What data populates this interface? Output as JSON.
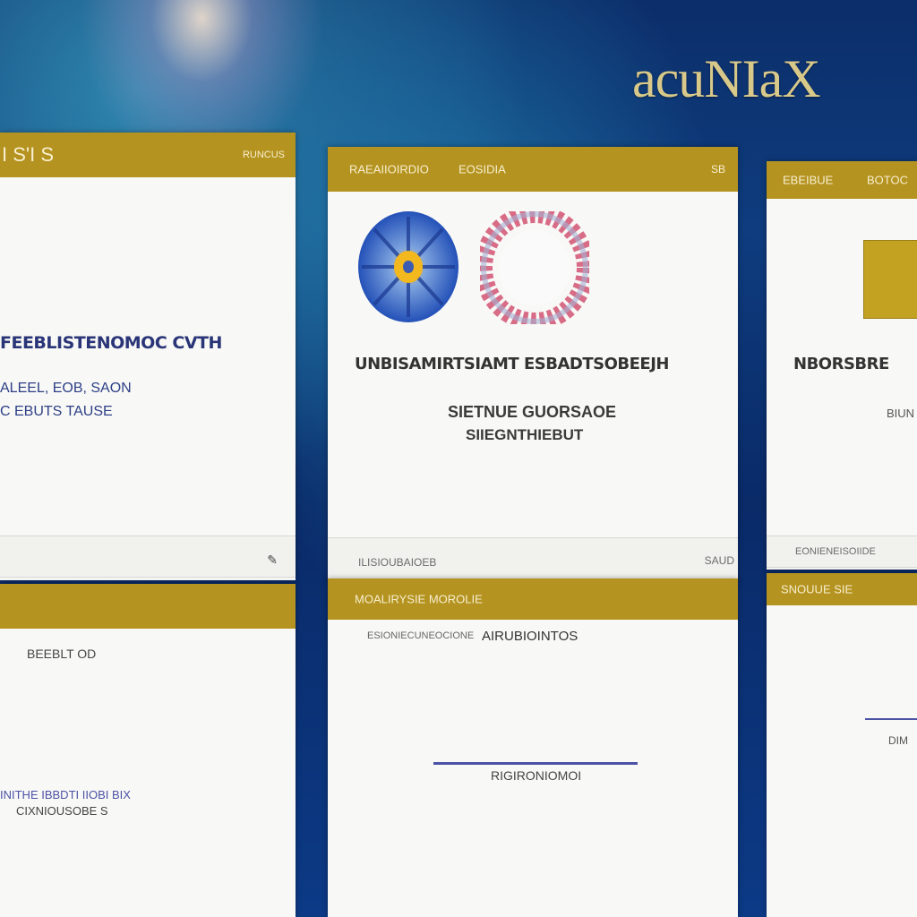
{
  "brand": "acuNIaX",
  "panel_left_top": {
    "bar_title": "I S'I S",
    "bar_action": "RUNCUS",
    "heading": "FEEBLISTENOMOC CVTH",
    "line1": "ALEEL, EOB, SAON",
    "line2": "C EBUTS TAUSE"
  },
  "panel_left_bottom": {
    "label": "BEEBLT OD",
    "line1": "INITHE IBBDTI IIOBI BIX",
    "line2": "CIXNIOUSOBE S"
  },
  "panel_center_top": {
    "bar_title": "RAEAIIOIRDIO",
    "bar_title2": "EOSIDIA",
    "bar_action": "SB",
    "heading": "UNBISAMIRTSIAMT ESBADTSOBEEJH",
    "line1": "SIETNUE GUORSAOE",
    "line2": "SIIEGNTHIEBUT",
    "footer_left": "ILISIOUBAIOEB",
    "footer_right": "SAUD"
  },
  "panel_center_bottom": {
    "bar_title": "MOALIRYSIE MOROLIE",
    "label_left": "ESIONIECUNEOCIONE",
    "label_right": "AIRUBIOINTOS",
    "line_caption": "RIGIRONIOMOI"
  },
  "panel_right_top": {
    "bar_title": "EBEIBUE",
    "bar_title2": "BOTOC",
    "heading": "NBORSBRE",
    "line1": "BIUN",
    "footer": "EONIENEISOIIDE"
  },
  "panel_right_bottom": {
    "bar_title": "SNOUUE SIE",
    "line_caption": "DIM"
  },
  "colors": {
    "accent_gold": "#b59320",
    "panel_bg": "#f8f8f6",
    "background_blue": "#0c2e6a",
    "line_blue": "#4b52a6"
  }
}
